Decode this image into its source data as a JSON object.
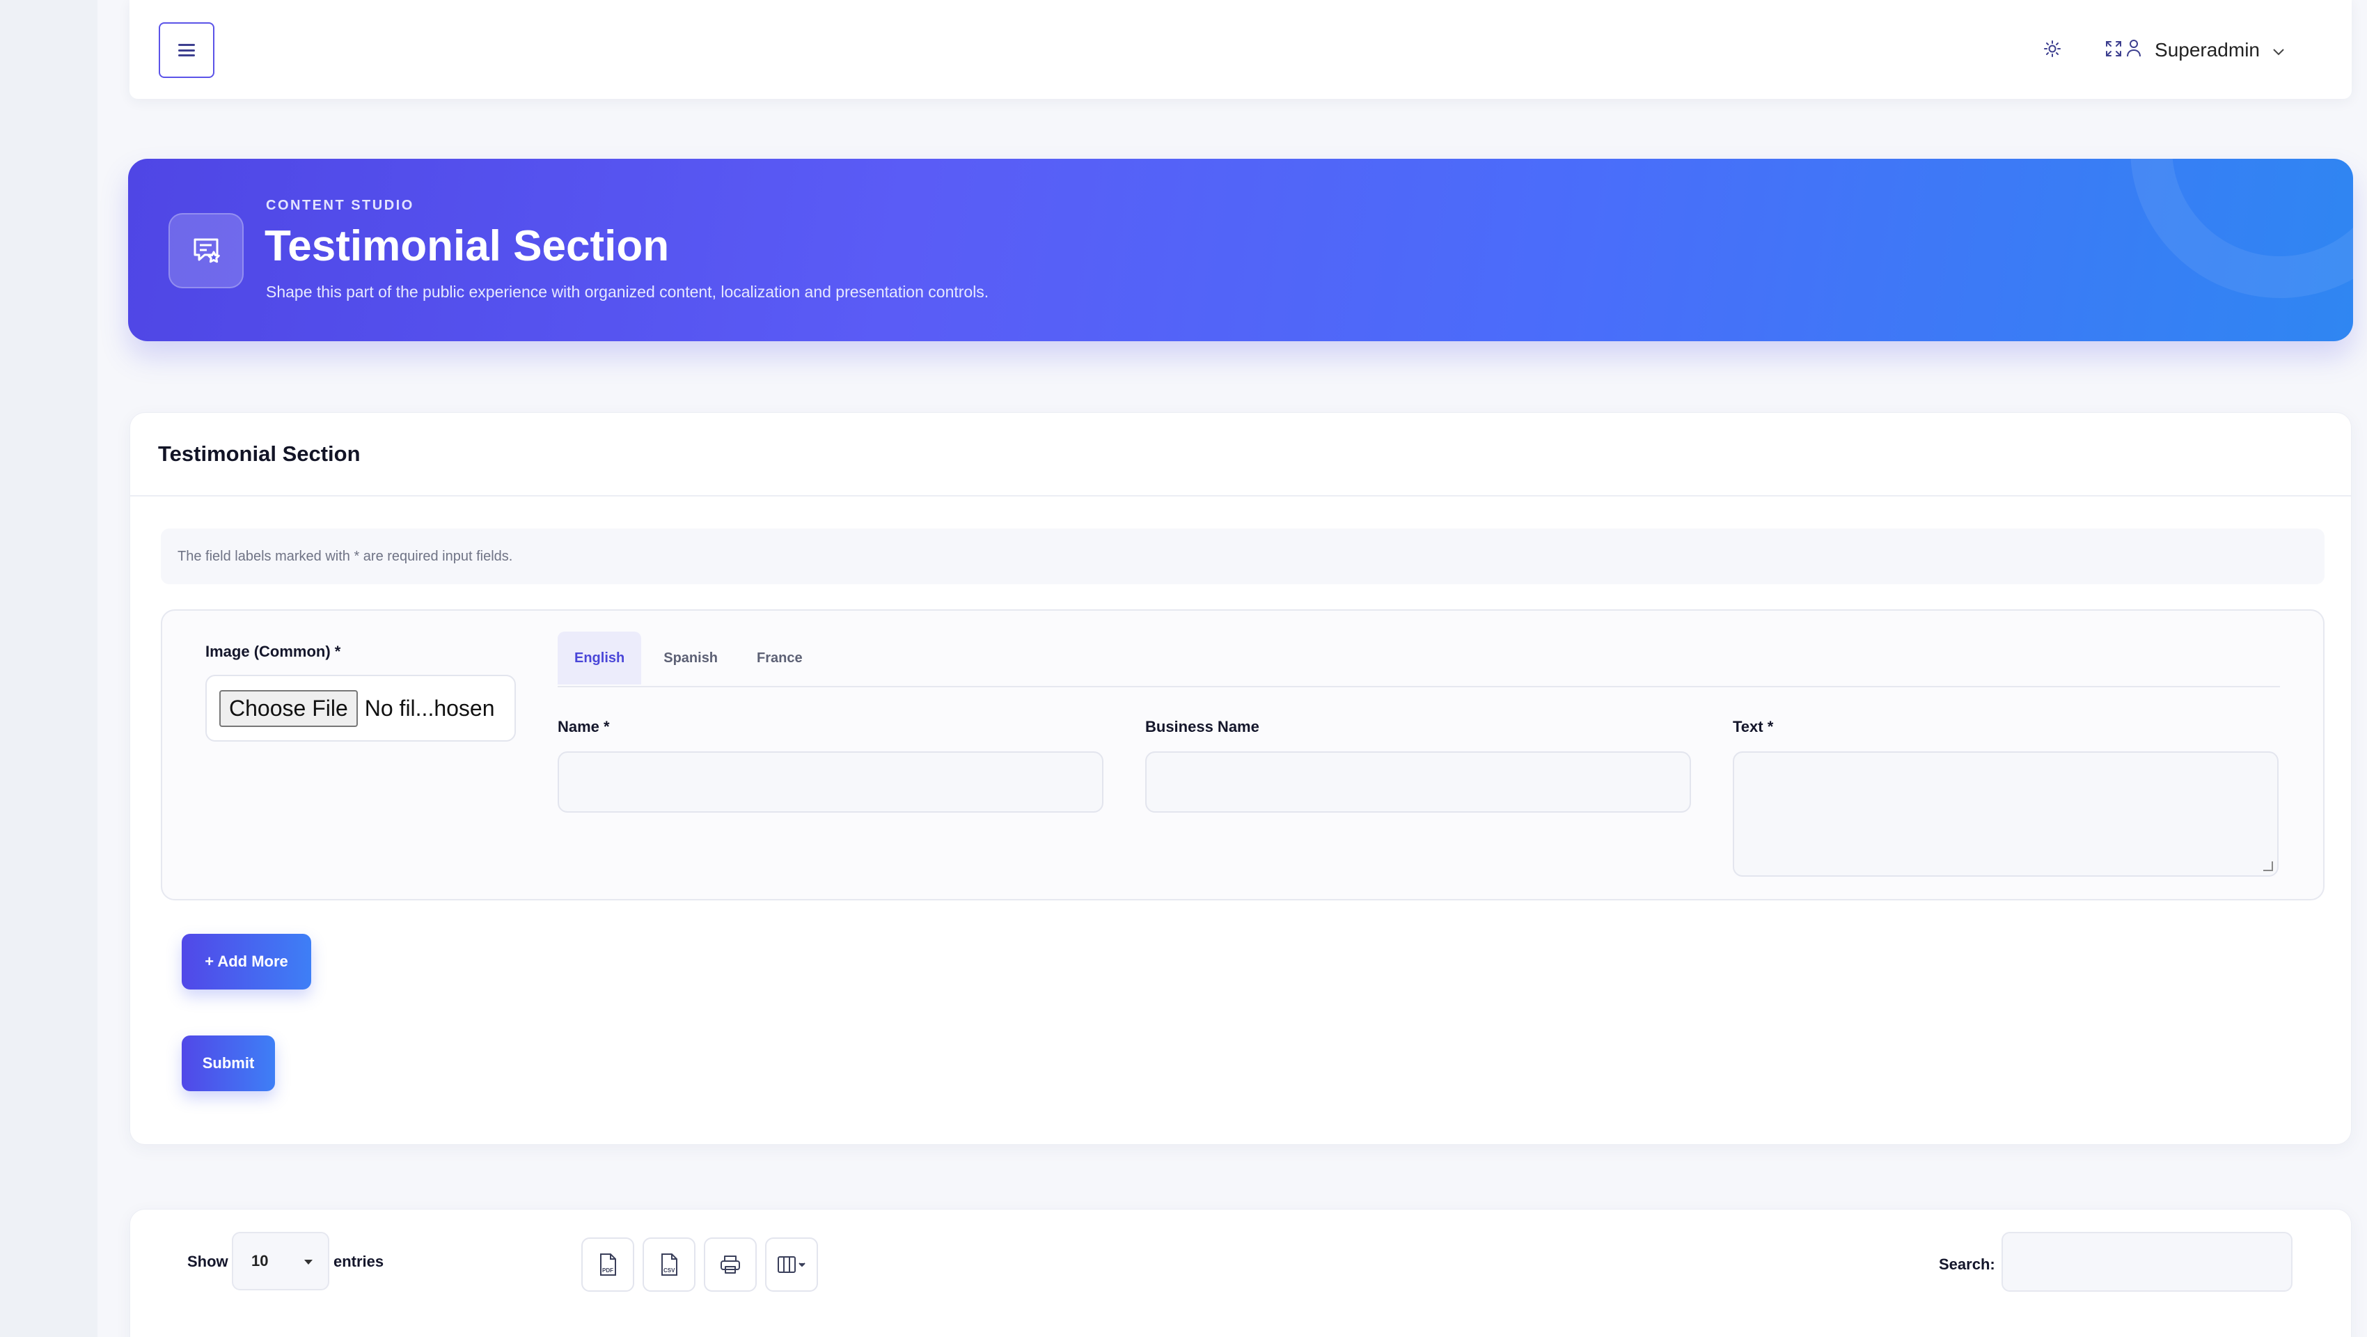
{
  "topbar": {
    "user_name": "Superadmin",
    "icons": [
      "menu-icon",
      "sun-icon",
      "fullscreen-icon",
      "user-icon",
      "chevron-down-icon"
    ]
  },
  "hero": {
    "eyebrow": "CONTENT STUDIO",
    "title": "Testimonial Section",
    "subtitle": "Shape this part of the public experience with organized content, localization and presentation controls.",
    "icon": "testimonial-star-chat-icon"
  },
  "form": {
    "header": "Testimonial Section",
    "note": "The field labels marked with * are required input fields.",
    "image_label": "Image (Common) *",
    "file_button": "Choose File",
    "file_status": "No fil...hosen",
    "tabs": [
      {
        "label": "English",
        "active": true
      },
      {
        "label": "Spanish",
        "active": false
      },
      {
        "label": "France",
        "active": false
      }
    ],
    "fields": {
      "name_label": "Name *",
      "name_value": "",
      "business_label": "Business Name",
      "business_value": "",
      "text_label": "Text *",
      "text_value": ""
    },
    "add_more_label": "+ Add More",
    "submit_label": "Submit"
  },
  "table_controls": {
    "show_label": "Show",
    "page_length": "10",
    "entries_label": "entries",
    "search_label": "Search:",
    "search_value": "",
    "tools": [
      "pdf-export-icon",
      "csv-export-icon",
      "print-icon",
      "column-visibility-icon"
    ]
  },
  "colors": {
    "accent": "#5148e8",
    "accent_end": "#3e7ff6",
    "hero_start": "#4f46e5",
    "hero_end": "#2f86f2"
  }
}
